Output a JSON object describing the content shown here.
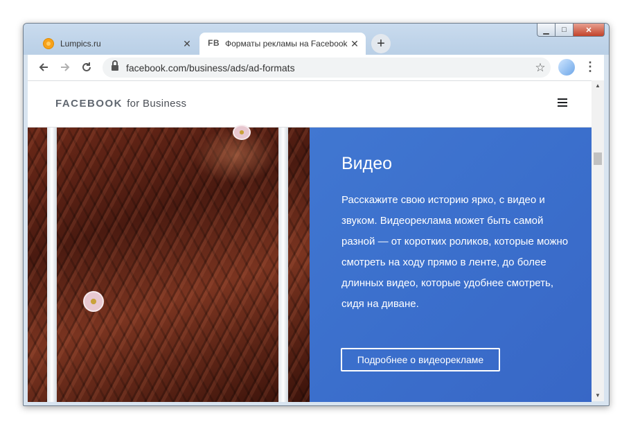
{
  "browser": {
    "tabs": [
      {
        "title": "Lumpics.ru",
        "favicon": "lumpics-favicon",
        "active": false
      },
      {
        "title": "Форматы рекламы на Facebook",
        "favicon_text": "FB",
        "active": true
      }
    ],
    "new_tab_label": "+",
    "close_glyph": "✕",
    "url": "facebook.com/business/ads/ad-formats",
    "window_controls": {
      "minimize": "▁",
      "maximize": "□",
      "close": "✕"
    }
  },
  "site": {
    "brand_facebook": "FACEBOOK",
    "brand_rest": "for Business"
  },
  "hero": {
    "title": "Видео",
    "body": "Расскажите свою историю ярко, с видео и звуком. Видеореклама может быть самой разной — от коротких роликов, которые можно смотреть на ходу прямо в ленте, до более длинных видео, которые удобнее смотреть, сидя на диване.",
    "cta_label": "Подробнее о видеорекламе"
  },
  "colors": {
    "panel_blue": "#3b6fcc",
    "hair_brown": "#5a2214"
  }
}
